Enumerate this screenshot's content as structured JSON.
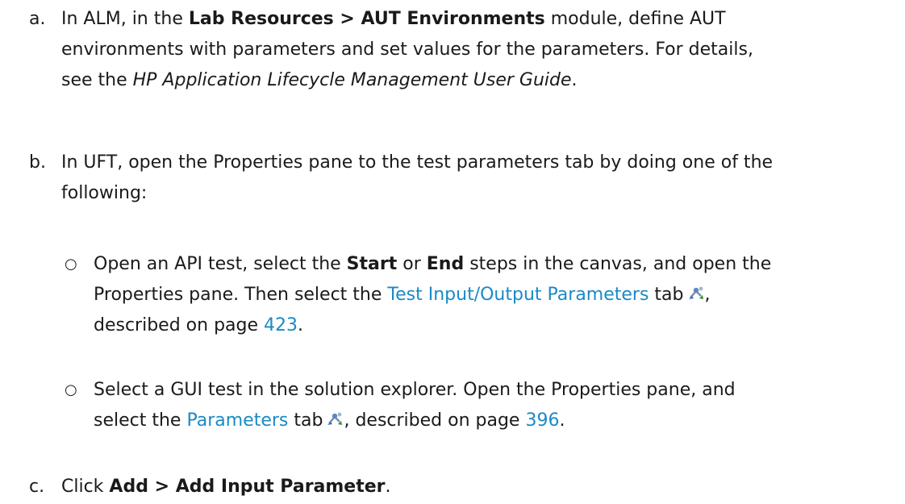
{
  "steps": [
    {
      "marker": "a.",
      "l1_pre": "In ALM, in the ",
      "l1_bold": "Lab Resources > AUT Environments",
      "l1_post": " module, define AUT",
      "l2": "environments with parameters and set values for the parameters. For details,",
      "l3_pre": "see the ",
      "l3_italic": "HP Application Lifecycle Management User Guide",
      "l3_post": "."
    },
    {
      "marker": "b.",
      "l1": "In UFT, open the Properties pane to the test parameters tab by doing one of the",
      "l2": "following:",
      "subitems": [
        {
          "bullet": "○",
          "l1_pre": "Open an API test, select the ",
          "l1_bold1": "Start",
          "l1_mid": " or ",
          "l1_bold2": "End",
          "l1_post": " steps in the canvas, and open the",
          "l2_pre": "Properties pane. Then select the ",
          "l2_link": "Test Input/Output Parameters",
          "l2_post": " tab",
          "l2_end": ",",
          "l3_pre": "described on page ",
          "l3_page": "423",
          "l3_post": "."
        },
        {
          "bullet": "○",
          "l1": "Select a GUI test in the solution explorer. Open the Properties pane, and",
          "l2_pre": "select the ",
          "l2_link": "Parameters",
          "l2_post": " tab",
          "l2_mid": ", described on page ",
          "l2_page": "396",
          "l2_end": "."
        }
      ]
    },
    {
      "marker": "c.",
      "l1_pre": "Click ",
      "l1_bold": "Add > Add Input Parameter",
      "l1_post": "."
    }
  ],
  "icons": [
    "parameters-icon"
  ],
  "colors": {
    "text": "#1a1a1a",
    "link": "#1a8ac6"
  }
}
